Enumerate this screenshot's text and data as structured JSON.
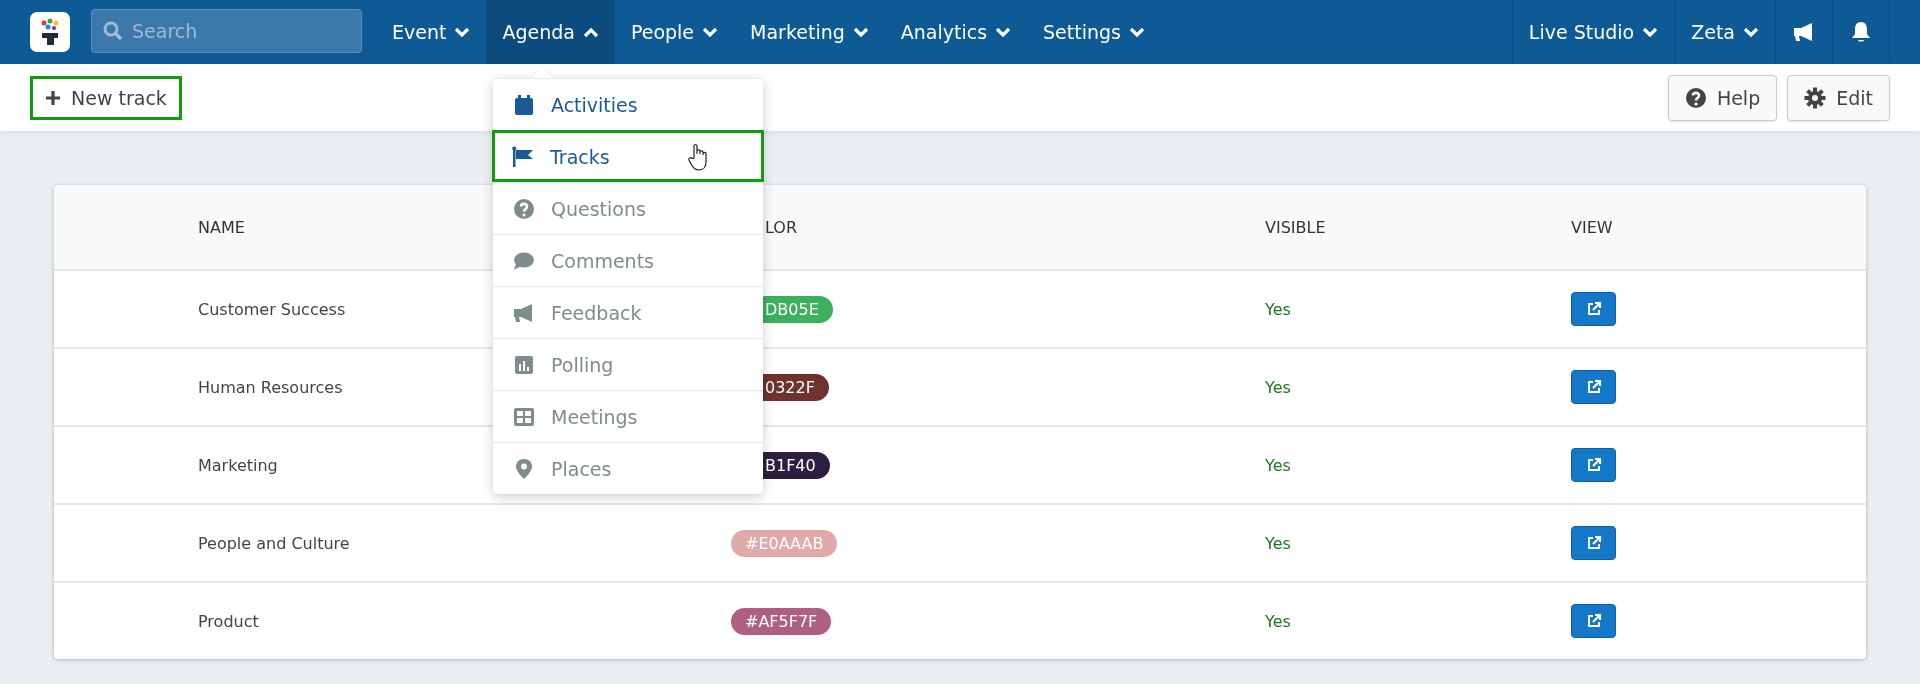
{
  "nav": {
    "search": {
      "placeholder": "Search"
    },
    "menus": [
      {
        "label": "Event",
        "expanded": false
      },
      {
        "label": "Agenda",
        "expanded": true
      },
      {
        "label": "People",
        "expanded": false
      },
      {
        "label": "Marketing",
        "expanded": false
      },
      {
        "label": "Analytics",
        "expanded": false
      },
      {
        "label": "Settings",
        "expanded": false
      }
    ],
    "right_menus": [
      {
        "label": "Live Studio",
        "expanded": false
      },
      {
        "label": "Zeta",
        "expanded": false
      }
    ]
  },
  "toolbar": {
    "new_button": "New track",
    "help_button": "Help",
    "edit_button": "Edit"
  },
  "agenda_menu": {
    "items": [
      {
        "label": "Activities",
        "disabled": false,
        "selected": false
      },
      {
        "label": "Tracks",
        "disabled": false,
        "selected": true
      },
      {
        "label": "Questions",
        "disabled": true,
        "selected": false
      },
      {
        "label": "Comments",
        "disabled": true,
        "selected": false
      },
      {
        "label": "Feedback",
        "disabled": true,
        "selected": false
      },
      {
        "label": "Polling",
        "disabled": true,
        "selected": false
      },
      {
        "label": "Meetings",
        "disabled": true,
        "selected": false
      },
      {
        "label": "Places",
        "disabled": true,
        "selected": false
      }
    ]
  },
  "table": {
    "columns": [
      {
        "label": "NAME",
        "kind": "full"
      },
      {
        "label": "LOR",
        "kind": "cut"
      },
      {
        "label": "VISIBLE",
        "kind": "full"
      },
      {
        "label": "VIEW",
        "kind": "full"
      }
    ],
    "rows": [
      {
        "name": "Customer Success",
        "color_badge": {
          "text": "DB05E",
          "color": "#3db05e",
          "kind": "cut"
        },
        "visible": "Yes"
      },
      {
        "name": "Human Resources",
        "color_badge": {
          "text": "0322F",
          "color": "#70322f",
          "kind": "cut"
        },
        "visible": "Yes"
      },
      {
        "name": "Marketing",
        "color_badge": {
          "text": "B1F40",
          "color": "#2b1f40",
          "kind": "cut"
        },
        "visible": "Yes"
      },
      {
        "name": "People and Culture",
        "color_badge": {
          "text": "#E0AAAB",
          "color": "#e0aaab",
          "kind": "full"
        },
        "visible": "Yes"
      },
      {
        "name": "Product",
        "color_badge": {
          "text": "#AF5F7F",
          "color": "#af5f7f",
          "kind": "full"
        },
        "visible": "Yes"
      }
    ]
  }
}
